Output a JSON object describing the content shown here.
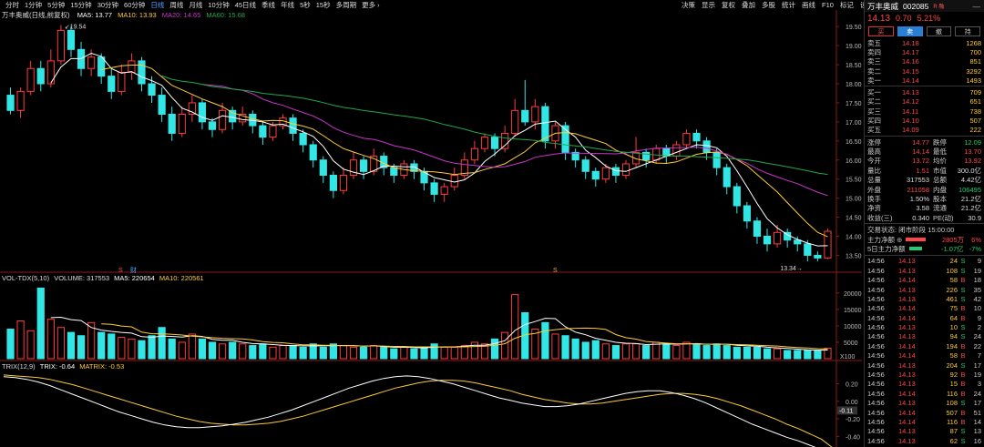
{
  "toolbar": {
    "items": [
      "分时",
      "1分钟",
      "5分钟",
      "15分钟",
      "30分钟",
      "60分钟",
      "日线",
      "周线",
      "月线",
      "10分钟",
      "45日线",
      "季线",
      "年线",
      "5秒",
      "15秒",
      "多周期",
      "更多 ›"
    ],
    "active": "日线",
    "right": [
      "决策",
      "显示",
      "复权",
      "叠加",
      "多股",
      "统计",
      "画线",
      "F10",
      "标记",
      "设置"
    ]
  },
  "stock": {
    "name": "万丰奥威",
    "code": "002085",
    "badge": "R 融",
    "price": "14.13",
    "change": "0.70",
    "change_pct": "5.21%"
  },
  "trade_buttons": [
    "买",
    "卖",
    "撤",
    "持"
  ],
  "chart_data": [
    {
      "type": "candlestick",
      "title": "万丰奥威(日线,前复权)",
      "legend": [
        {
          "label": "MA5: 13.77",
          "color": "#ffffff"
        },
        {
          "label": "MA10: 13.93",
          "color": "#ffcc33"
        },
        {
          "label": "MA20: 14.65",
          "color": "#cc33cc"
        },
        {
          "label": "MA60: 15.68",
          "color": "#1fa84a"
        }
      ],
      "yticks": [
        "19.50",
        "19.00",
        "18.50",
        "18.00",
        "17.50",
        "17.00",
        "16.50",
        "16.00",
        "15.50",
        "15.00",
        "14.50",
        "14.00",
        "13.50"
      ],
      "ylim": [
        13.2,
        19.6
      ],
      "annotations": {
        "high": "19.54",
        "low": "13.34",
        "marker_red": "S",
        "marker_blue": "财"
      },
      "candles": [
        [
          17.7,
          17.3,
          17.9,
          17.2
        ],
        [
          17.3,
          17.8,
          17.9,
          17.1
        ],
        [
          17.8,
          18.4,
          18.6,
          17.7
        ],
        [
          18.4,
          18.0,
          18.6,
          17.8
        ],
        [
          18.0,
          18.6,
          18.9,
          17.9
        ],
        [
          18.6,
          19.4,
          19.54,
          18.5
        ],
        [
          19.4,
          18.9,
          19.5,
          18.7
        ],
        [
          18.9,
          18.4,
          19.1,
          18.2
        ],
        [
          18.4,
          18.7,
          18.9,
          18.2
        ],
        [
          18.7,
          18.2,
          18.8,
          18.0
        ],
        [
          18.2,
          17.8,
          18.4,
          17.6
        ],
        [
          17.8,
          18.3,
          18.5,
          17.7
        ],
        [
          18.3,
          18.6,
          18.8,
          18.1
        ],
        [
          18.6,
          18.0,
          18.7,
          17.8
        ],
        [
          18.0,
          17.7,
          18.2,
          17.5
        ],
        [
          17.7,
          17.2,
          17.9,
          17.0
        ],
        [
          17.2,
          16.7,
          17.4,
          16.5
        ],
        [
          16.7,
          17.2,
          17.4,
          16.6
        ],
        [
          17.2,
          17.5,
          17.7,
          17.0
        ],
        [
          17.5,
          17.0,
          17.6,
          16.8
        ],
        [
          17.0,
          16.8,
          17.1,
          16.6
        ],
        [
          16.8,
          17.3,
          17.5,
          16.7
        ],
        [
          17.3,
          17.0,
          17.4,
          16.8
        ],
        [
          17.0,
          17.2,
          17.4,
          16.9
        ],
        [
          17.2,
          16.9,
          17.3,
          16.7
        ],
        [
          16.9,
          16.6,
          17.0,
          16.4
        ],
        [
          16.6,
          16.9,
          17.0,
          16.5
        ],
        [
          16.9,
          17.1,
          17.2,
          16.8
        ],
        [
          17.1,
          16.7,
          17.2,
          16.5
        ],
        [
          16.7,
          16.4,
          16.8,
          16.2
        ],
        [
          16.4,
          16.0,
          16.5,
          15.8
        ],
        [
          16.0,
          15.6,
          16.1,
          15.4
        ],
        [
          15.6,
          15.2,
          15.7,
          15.0
        ],
        [
          15.2,
          15.6,
          15.8,
          15.1
        ],
        [
          15.6,
          16.0,
          16.2,
          15.5
        ],
        [
          16.0,
          15.7,
          16.1,
          15.5
        ],
        [
          15.7,
          16.1,
          16.3,
          15.6
        ],
        [
          16.1,
          15.8,
          16.2,
          15.6
        ],
        [
          15.8,
          15.6,
          15.9,
          15.4
        ],
        [
          15.6,
          15.9,
          16.0,
          15.5
        ],
        [
          15.9,
          15.7,
          16.0,
          15.5
        ],
        [
          15.7,
          15.4,
          15.8,
          15.2
        ],
        [
          15.4,
          15.1,
          15.5,
          14.9
        ],
        [
          15.1,
          15.3,
          15.4,
          14.9
        ],
        [
          15.3,
          15.6,
          15.8,
          15.2
        ],
        [
          15.6,
          16.0,
          16.2,
          15.5
        ],
        [
          16.0,
          16.3,
          16.5,
          15.9
        ],
        [
          16.3,
          16.6,
          16.7,
          16.2
        ],
        [
          16.6,
          16.3,
          16.7,
          16.1
        ],
        [
          16.3,
          16.7,
          16.9,
          16.2
        ],
        [
          16.7,
          17.3,
          17.6,
          16.6
        ],
        [
          17.3,
          17.0,
          18.1,
          16.9
        ],
        [
          17.0,
          17.4,
          17.6,
          16.8
        ],
        [
          17.4,
          16.5,
          17.5,
          16.3
        ],
        [
          16.5,
          16.9,
          17.0,
          16.3
        ],
        [
          16.9,
          16.2,
          17.0,
          16.0
        ],
        [
          16.2,
          16.0,
          16.3,
          15.8
        ],
        [
          16.0,
          15.7,
          16.1,
          15.5
        ],
        [
          15.7,
          15.5,
          15.8,
          15.3
        ],
        [
          15.5,
          15.8,
          15.9,
          15.4
        ],
        [
          15.8,
          15.6,
          15.9,
          15.4
        ],
        [
          15.6,
          15.9,
          16.0,
          15.5
        ],
        [
          15.9,
          16.2,
          16.6,
          15.8
        ],
        [
          16.2,
          16.0,
          16.3,
          15.8
        ],
        [
          16.0,
          16.3,
          16.4,
          15.9
        ],
        [
          16.3,
          16.1,
          16.4,
          15.9
        ],
        [
          16.1,
          16.4,
          16.5,
          16.0
        ],
        [
          16.4,
          16.7,
          16.8,
          16.3
        ],
        [
          16.7,
          16.5,
          16.8,
          16.3
        ],
        [
          16.5,
          16.2,
          16.6,
          16.0
        ],
        [
          16.2,
          15.8,
          16.3,
          15.6
        ],
        [
          15.8,
          15.3,
          15.9,
          15.1
        ],
        [
          15.3,
          14.8,
          15.4,
          14.6
        ],
        [
          14.8,
          14.4,
          14.9,
          14.2
        ],
        [
          14.4,
          14.0,
          14.5,
          13.8
        ],
        [
          14.0,
          13.8,
          14.2,
          13.6
        ],
        [
          13.8,
          14.1,
          14.3,
          13.7
        ],
        [
          14.1,
          13.9,
          14.2,
          13.7
        ],
        [
          13.9,
          13.8,
          14.0,
          13.6
        ],
        [
          13.8,
          13.5,
          13.9,
          13.34
        ],
        [
          13.5,
          13.43,
          13.6,
          13.34
        ],
        [
          13.43,
          14.13,
          14.2,
          13.4
        ]
      ]
    },
    {
      "type": "bar",
      "title": "VOL-TDX(5,10) VOLUME: 317553",
      "legend": [
        {
          "label": "VOL-TDX(5,10)",
          "color": "#cccccc"
        },
        {
          "label": "VOLUME: 317553",
          "color": "#cccccc"
        },
        {
          "label": "MA5: 220654",
          "color": "#ffffff"
        },
        {
          "label": "MA10: 220561",
          "color": "#ffcc33"
        }
      ],
      "yticks": [
        "20000",
        "15000",
        "10000",
        "5000",
        "X100"
      ],
      "ylim": [
        0,
        23000
      ],
      "values": [
        9000,
        11500,
        8500,
        21500,
        12000,
        9500,
        8000,
        7000,
        11000,
        8000,
        7500,
        6500,
        6000,
        5500,
        7000,
        9500,
        6000,
        5000,
        7500,
        6000,
        5000,
        4500,
        5000,
        4500,
        4000,
        4500,
        3500,
        4000,
        4000,
        3500,
        4500,
        3500,
        4500,
        4000,
        3500,
        3500,
        4000,
        3500,
        3000,
        3500,
        3000,
        3500,
        4500,
        3500,
        3500,
        4000,
        5000,
        4500,
        6000,
        8000,
        19500,
        14000,
        9000,
        11000,
        7500,
        7000,
        6000,
        5000,
        5500,
        4500,
        4000,
        4500,
        4500,
        4000,
        5000,
        4500,
        4000,
        5000,
        4500,
        4000,
        4500,
        4000,
        3500,
        3500,
        3500,
        3000,
        3000,
        2500,
        2500,
        2500,
        2500,
        3200
      ]
    },
    {
      "type": "line",
      "title": "TRIX(12,9)",
      "legend": [
        {
          "label": "TRIX(12,9)",
          "color": "#cccccc"
        },
        {
          "label": "TRIX: -0.64",
          "color": "#ffffff"
        },
        {
          "label": "MATRIX: -0.53",
          "color": "#ffcc33"
        }
      ],
      "yticks": [
        "0.20",
        "0.00",
        "-0.20",
        "-0.40"
      ],
      "current_label": "-0.11",
      "ylim": [
        -0.5,
        0.33
      ],
      "series": [
        {
          "name": "TRIX",
          "values": [
            0.28,
            0.27,
            0.25,
            0.22,
            0.18,
            0.13,
            0.08,
            0.03,
            -0.02,
            -0.07,
            -0.12,
            -0.16,
            -0.2,
            -0.24,
            -0.27,
            -0.29,
            -0.3,
            -0.3,
            -0.29,
            -0.28,
            -0.26,
            -0.24,
            -0.21,
            -0.18,
            -0.14,
            -0.1,
            -0.05,
            0.0,
            0.05,
            0.1,
            0.15,
            0.19,
            0.23,
            0.26,
            0.28,
            0.29,
            0.28,
            0.26,
            0.23,
            0.2,
            0.16,
            0.12,
            0.08,
            0.04,
            0.01,
            -0.02,
            -0.04,
            -0.06,
            -0.06,
            -0.05,
            -0.03,
            0.0,
            0.03,
            0.06,
            0.09,
            0.11,
            0.12,
            0.12,
            0.1,
            0.07,
            0.03,
            -0.02,
            -0.08,
            -0.14,
            -0.2,
            -0.26,
            -0.31,
            -0.36,
            -0.41,
            -0.45,
            -0.5,
            -0.55,
            -0.64
          ]
        },
        {
          "name": "MATRIX",
          "values": [
            0.3,
            0.29,
            0.28,
            0.27,
            0.25,
            0.22,
            0.19,
            0.15,
            0.11,
            0.07,
            0.03,
            -0.01,
            -0.05,
            -0.09,
            -0.13,
            -0.17,
            -0.2,
            -0.23,
            -0.25,
            -0.26,
            -0.27,
            -0.27,
            -0.26,
            -0.25,
            -0.23,
            -0.2,
            -0.17,
            -0.13,
            -0.09,
            -0.05,
            -0.01,
            0.03,
            0.07,
            0.11,
            0.15,
            0.18,
            0.21,
            0.23,
            0.24,
            0.24,
            0.23,
            0.21,
            0.18,
            0.15,
            0.12,
            0.08,
            0.05,
            0.02,
            0.0,
            -0.02,
            -0.03,
            -0.03,
            -0.02,
            0.0,
            0.02,
            0.04,
            0.06,
            0.08,
            0.09,
            0.09,
            0.08,
            0.06,
            0.03,
            -0.01,
            -0.05,
            -0.1,
            -0.15,
            -0.2,
            -0.26,
            -0.31,
            -0.37,
            -0.43,
            -0.53
          ]
        }
      ]
    }
  ],
  "orderbook": {
    "asks": [
      {
        "label": "卖五",
        "price": "14.18",
        "vol": "1268"
      },
      {
        "label": "卖四",
        "price": "14.17",
        "vol": "700"
      },
      {
        "label": "卖三",
        "price": "14.16",
        "vol": "851"
      },
      {
        "label": "卖二",
        "price": "14.15",
        "vol": "3292"
      },
      {
        "label": "卖一",
        "price": "14.14",
        "vol": "1493"
      }
    ],
    "bids": [
      {
        "label": "买一",
        "price": "14.13",
        "vol": "709"
      },
      {
        "label": "买二",
        "price": "14.12",
        "vol": "651"
      },
      {
        "label": "买三",
        "price": "14.11",
        "vol": "738"
      },
      {
        "label": "买四",
        "price": "14.10",
        "vol": "507"
      },
      {
        "label": "买五",
        "price": "14.09",
        "vol": "222"
      }
    ]
  },
  "stats": [
    {
      "k1": "涨停",
      "v1": "14.77",
      "c1": "red",
      "k2": "跌停",
      "v2": "12.09",
      "c2": "green"
    },
    {
      "k1": "最高",
      "v1": "14.14",
      "c1": "red",
      "k2": "最低",
      "v2": "13.70",
      "c2": "red"
    },
    {
      "k1": "今开",
      "v1": "13.72",
      "c1": "red",
      "k2": "均价",
      "v2": "13.92",
      "c2": "red"
    },
    {
      "k1": "量比",
      "v1": "1.51",
      "c1": "red",
      "k2": "市值",
      "v2": "300.0亿",
      "c2": "wht"
    },
    {
      "k1": "总量",
      "v1": "317553",
      "c1": "wht",
      "k2": "总额",
      "v2": "4.42亿",
      "c2": "wht"
    },
    {
      "k1": "外盘",
      "v1": "211058",
      "c1": "red",
      "k2": "内盘",
      "v2": "106495",
      "c2": "green"
    },
    {
      "k1": "换手",
      "v1": "1.50%",
      "c1": "wht",
      "k2": "股本",
      "v2": "21.2亿",
      "c2": "wht"
    },
    {
      "k1": "净资",
      "v1": "3.58",
      "c1": "wht",
      "k2": "流通",
      "v2": "21.2亿",
      "c2": "wht"
    },
    {
      "k1": "收益(三)",
      "v1": "0.340",
      "c1": "wht",
      "k2": "PE(动)",
      "v2": "30.9",
      "c2": "wht"
    }
  ],
  "status": {
    "text": "交易状态: 闭市阶段 15:00:00",
    "main_flow_label": "主力净额",
    "main_flow_value": "2805万",
    "main_flow_pct": "6%",
    "main_flow5_label": "5日主力净额",
    "main_flow5_value": "-1.07亿",
    "main_flow5_pct": "-7%"
  },
  "ticks": [
    {
      "t": "14:56",
      "p": "14.13",
      "v": "24",
      "bs": "S",
      "n": "9"
    },
    {
      "t": "14:56",
      "p": "14.13",
      "v": "108",
      "bs": "S",
      "n": "19"
    },
    {
      "t": "14:56",
      "p": "14.14",
      "v": "58",
      "bs": "B",
      "n": "18"
    },
    {
      "t": "14:56",
      "p": "14.13",
      "v": "226",
      "bs": "S",
      "n": "35"
    },
    {
      "t": "14:56",
      "p": "14.13",
      "v": "461",
      "bs": "S",
      "n": "42"
    },
    {
      "t": "14:56",
      "p": "14.14",
      "v": "75",
      "bs": "B",
      "n": "10"
    },
    {
      "t": "14:56",
      "p": "14.14",
      "v": "64",
      "bs": "B",
      "n": "9"
    },
    {
      "t": "14:56",
      "p": "14.13",
      "v": "10",
      "bs": "S",
      "n": "2"
    },
    {
      "t": "14:56",
      "p": "14.13",
      "v": "94",
      "bs": "S",
      "n": "24"
    },
    {
      "t": "14:56",
      "p": "14.14",
      "v": "194",
      "bs": "B",
      "n": "22"
    },
    {
      "t": "14:56",
      "p": "14.14",
      "v": "58",
      "bs": "B",
      "n": "7"
    },
    {
      "t": "14:56",
      "p": "14.13",
      "v": "204",
      "bs": "S",
      "n": "17"
    },
    {
      "t": "14:56",
      "p": "14.13",
      "v": "92",
      "bs": "B",
      "n": "19"
    },
    {
      "t": "14:56",
      "p": "14.13",
      "v": "15",
      "bs": "B",
      "n": "3"
    },
    {
      "t": "14:56",
      "p": "14.14",
      "v": "116",
      "bs": "B",
      "n": "24"
    },
    {
      "t": "14:56",
      "p": "14.13",
      "v": "108",
      "bs": "S",
      "n": "17"
    },
    {
      "t": "14:56",
      "p": "14.14",
      "v": "507",
      "bs": "B",
      "n": "51"
    },
    {
      "t": "14:56",
      "p": "14.14",
      "v": "116",
      "bs": "B",
      "n": "14"
    },
    {
      "t": "14:56",
      "p": "14.13",
      "v": "87",
      "bs": "S",
      "n": "13"
    },
    {
      "t": "14:56",
      "p": "14.13",
      "v": "62",
      "bs": "S",
      "n": "16"
    }
  ]
}
